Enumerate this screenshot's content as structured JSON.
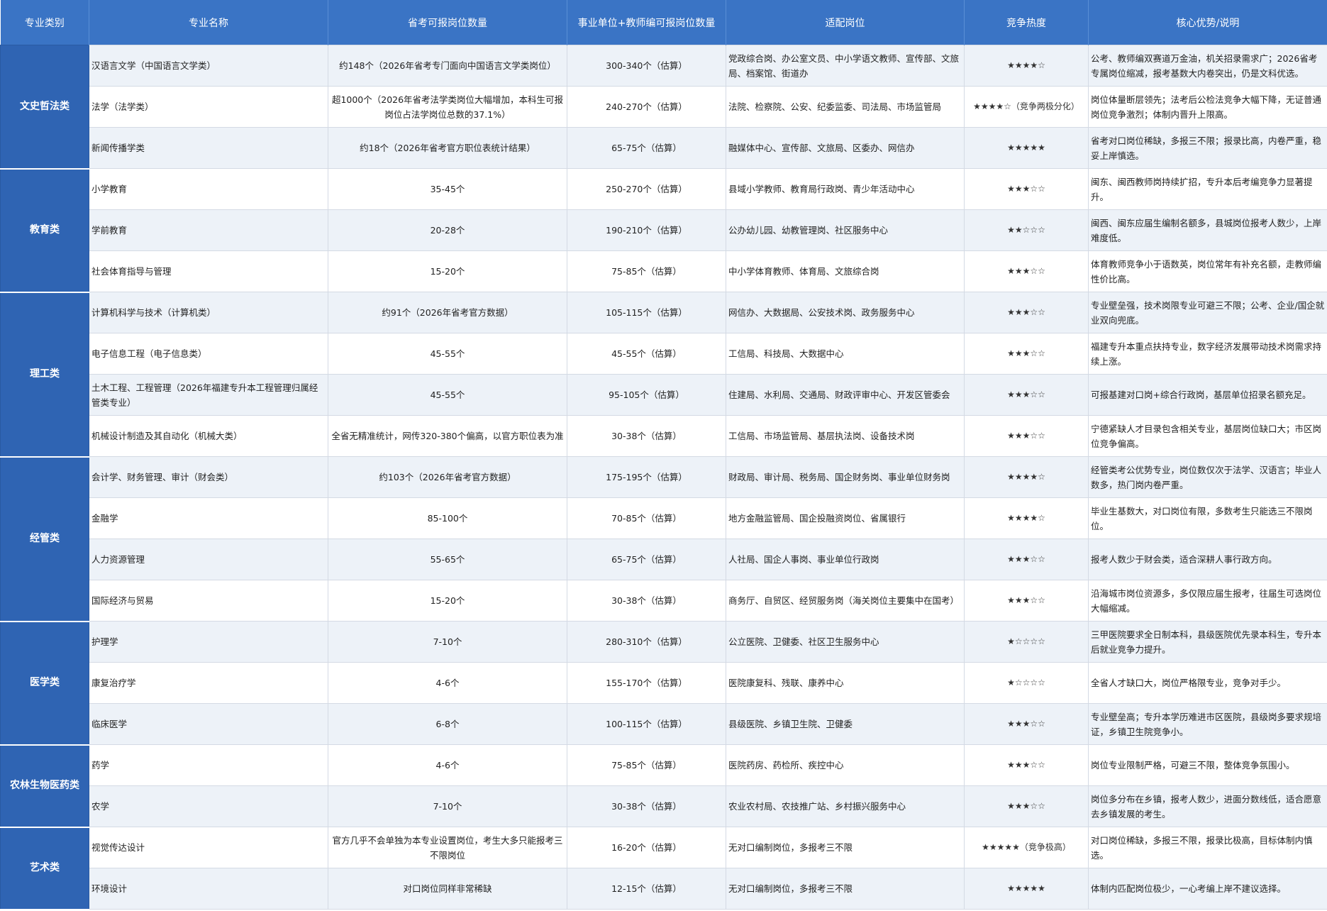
{
  "headers": [
    "专业类别",
    "专业名称",
    "省考可报岗位数量",
    "事业单位+教师编可报岗位数量",
    "适配岗位",
    "竞争热度",
    "核心优势/说明"
  ],
  "groups": [
    {
      "category": "文史哲法类",
      "rows": [
        {
          "major": "汉语言文学（中国语言文学类）",
          "province": "约148个（2026年省考专门面向中国语言文学类岗位）",
          "institution": "300-340个（估算）",
          "positions": "党政综合岗、办公室文员、中小学语文教师、宣传部、文旅局、档案馆、街道办",
          "heat": "★★★★☆",
          "note": "公考、教师编双赛道万金油，机关招录需求广；2026省考专属岗位缩减，报考基数大内卷突出，仍是文科优选。"
        },
        {
          "major": "法学（法学类）",
          "province": "超1000个（2026年省考法学类岗位大幅增加，本科生可报岗位占法学岗位总数的37.1%）",
          "institution": "240-270个（估算）",
          "positions": "法院、检察院、公安、纪委监委、司法局、市场监管局",
          "heat": "★★★★☆（竞争两极分化）",
          "note": "岗位体量断层领先；法考后公检法竞争大幅下降，无证普通岗位竞争激烈；体制内晋升上限高。"
        },
        {
          "major": "新闻传播学类",
          "province": "约18个（2026年省考官方职位表统计结果）",
          "institution": "65-75个（估算）",
          "positions": "融媒体中心、宣传部、文旅局、区委办、网信办",
          "heat": "★★★★★",
          "note": "省考对口岗位稀缺，多报三不限；报录比高，内卷严重，稳妥上岸慎选。"
        }
      ]
    },
    {
      "category": "教育类",
      "rows": [
        {
          "major": "小学教育",
          "province": "35-45个",
          "institution": "250-270个（估算）",
          "positions": "县域小学教师、教育局行政岗、青少年活动中心",
          "heat": "★★★☆☆",
          "note": "闽东、闽西教师岗持续扩招，专升本后考编竞争力显著提升。"
        },
        {
          "major": "学前教育",
          "province": "20-28个",
          "institution": "190-210个（估算）",
          "positions": "公办幼儿园、幼教管理岗、社区服务中心",
          "heat": "★★☆☆☆",
          "note": "闽西、闽东应届生编制名额多，县城岗位报考人数少，上岸难度低。"
        },
        {
          "major": "社会体育指导与管理",
          "province": "15-20个",
          "institution": "75-85个（估算）",
          "positions": "中小学体育教师、体育局、文旅综合岗",
          "heat": "★★★☆☆",
          "note": "体育教师竞争小于语数英，岗位常年有补充名额，走教师编性价比高。"
        }
      ]
    },
    {
      "category": "理工类",
      "rows": [
        {
          "major": "计算机科学与技术（计算机类）",
          "province": "约91个（2026年省考官方数据）",
          "institution": "105-115个（估算）",
          "positions": "网信办、大数据局、公安技术岗、政务服务中心",
          "heat": "★★★☆☆",
          "note": "专业壁垒强，技术岗限专业可避三不限；公考、企业/国企就业双向兜底。"
        },
        {
          "major": "电子信息工程（电子信息类）",
          "province": "45-55个",
          "institution": "45-55个（估算）",
          "positions": "工信局、科技局、大数据中心",
          "heat": "★★★☆☆",
          "note": "福建专升本重点扶持专业，数字经济发展带动技术岗需求持续上涨。"
        },
        {
          "major": "土木工程、工程管理（2026年福建专升本工程管理归属经管类专业）",
          "province": "45-55个",
          "institution": "95-105个（估算）",
          "positions": "住建局、水利局、交通局、财政评审中心、开发区管委会",
          "heat": "★★★☆☆",
          "note": "可报基建对口岗+综合行政岗，基层单位招录名额充足。"
        },
        {
          "major": "机械设计制造及其自动化（机械大类）",
          "province": "全省无精准统计，网传320-380个偏高，以官方职位表为准",
          "institution": "30-38个（估算）",
          "positions": "工信局、市场监管局、基层执法岗、设备技术岗",
          "heat": "★★★☆☆",
          "note": "宁德紧缺人才目录包含相关专业，基层岗位缺口大；市区岗位竞争偏高。"
        }
      ]
    },
    {
      "category": "经管类",
      "rows": [
        {
          "major": "会计学、财务管理、审计（财会类）",
          "province": "约103个（2026年省考官方数据）",
          "institution": "175-195个（估算）",
          "positions": "财政局、审计局、税务局、国企财务岗、事业单位财务岗",
          "heat": "★★★★☆",
          "note": "经管类考公优势专业，岗位数仅次于法学、汉语言；毕业人数多，热门岗内卷严重。"
        },
        {
          "major": "金融学",
          "province": "85-100个",
          "institution": "70-85个（估算）",
          "positions": "地方金融监管局、国企投融资岗位、省属银行",
          "heat": "★★★★☆",
          "note": "毕业生基数大，对口岗位有限，多数考生只能选三不限岗位。"
        },
        {
          "major": "人力资源管理",
          "province": "55-65个",
          "institution": "65-75个（估算）",
          "positions": "人社局、国企人事岗、事业单位行政岗",
          "heat": "★★★☆☆",
          "note": "报考人数少于财会类，适合深耕人事行政方向。"
        },
        {
          "major": "国际经济与贸易",
          "province": "15-20个",
          "institution": "30-38个（估算）",
          "positions": "商务厅、自贸区、经贸服务岗（海关岗位主要集中在国考）",
          "heat": "★★★☆☆",
          "note": "沿海城市岗位资源多，多仅限应届生报考，往届生可选岗位大幅缩减。"
        }
      ]
    },
    {
      "category": "医学类",
      "rows": [
        {
          "major": "护理学",
          "province": "7-10个",
          "institution": "280-310个（估算）",
          "positions": "公立医院、卫健委、社区卫生服务中心",
          "heat": "★☆☆☆☆",
          "note": "三甲医院要求全日制本科，县级医院优先录本科生，专升本后就业竞争力提升。"
        },
        {
          "major": "康复治疗学",
          "province": "4-6个",
          "institution": "155-170个（估算）",
          "positions": "医院康复科、残联、康养中心",
          "heat": "★☆☆☆☆",
          "note": "全省人才缺口大，岗位严格限专业，竞争对手少。"
        },
        {
          "major": "临床医学",
          "province": "6-8个",
          "institution": "100-115个（估算）",
          "positions": "县级医院、乡镇卫生院、卫健委",
          "heat": "★★★☆☆",
          "note": "专业壁垒高；专升本学历难进市区医院，县级岗多要求规培证，乡镇卫生院竞争小。"
        }
      ]
    },
    {
      "category": "农林生物医药类",
      "rows": [
        {
          "major": "药学",
          "province": "4-6个",
          "institution": "75-85个（估算）",
          "positions": "医院药房、药检所、疾控中心",
          "heat": "★★★☆☆",
          "note": "岗位专业限制严格，可避三不限，整体竞争氛围小。"
        },
        {
          "major": "农学",
          "province": "7-10个",
          "institution": "30-38个（估算）",
          "positions": "农业农村局、农技推广站、乡村振兴服务中心",
          "heat": "★★★☆☆",
          "note": "岗位多分布在乡镇，报考人数少，进面分数线低，适合愿意去乡镇发展的考生。"
        }
      ]
    },
    {
      "category": "艺术类",
      "rows": [
        {
          "major": "视觉传达设计",
          "province": "官方几乎不会单独为本专业设置岗位，考生大多只能报考三不限岗位",
          "institution": "16-20个（估算）",
          "positions": "无对口编制岗位，多报考三不限",
          "heat": "★★★★★（竞争极高）",
          "note": "对口岗位稀缺，多报三不限，报录比极高，目标体制内慎选。"
        },
        {
          "major": "环境设计",
          "province": "对口岗位同样非常稀缺",
          "institution": "12-15个（估算）",
          "positions": "无对口编制岗位，多报考三不限",
          "heat": "★★★★★",
          "note": "体制内匹配岗位极少，一心考编上岸不建议选择。"
        }
      ]
    }
  ]
}
